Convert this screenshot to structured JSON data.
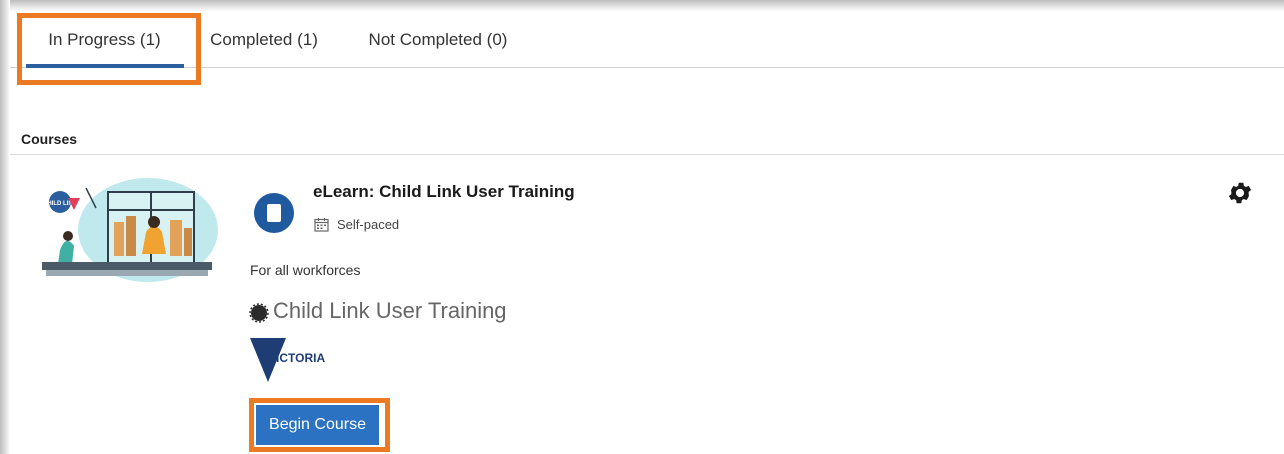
{
  "tabs": [
    {
      "label": "In Progress (1)",
      "active": true
    },
    {
      "label": "Completed (1)",
      "active": false
    },
    {
      "label": "Not Completed (0)",
      "active": false
    }
  ],
  "section": {
    "heading": "Courses"
  },
  "course": {
    "title": "eLearn: Child Link User Training",
    "pace": "Self-paced",
    "description": "For all workforces",
    "subtitle": "Child Link User Training",
    "provider_logo_text": "VICTORIA",
    "thumbnail_logo_text": "CHILD LINK",
    "begin_label": "Begin Course"
  },
  "icons": {
    "course_type": "book-icon",
    "calendar": "calendar-icon",
    "settings": "gear-icon",
    "bullet": "loading-spinner-icon"
  },
  "colors": {
    "accent": "#2b73c2",
    "tab_underline": "#2b5fa0",
    "highlight": "#ec7a23",
    "course_icon": "#1f5a9e"
  }
}
